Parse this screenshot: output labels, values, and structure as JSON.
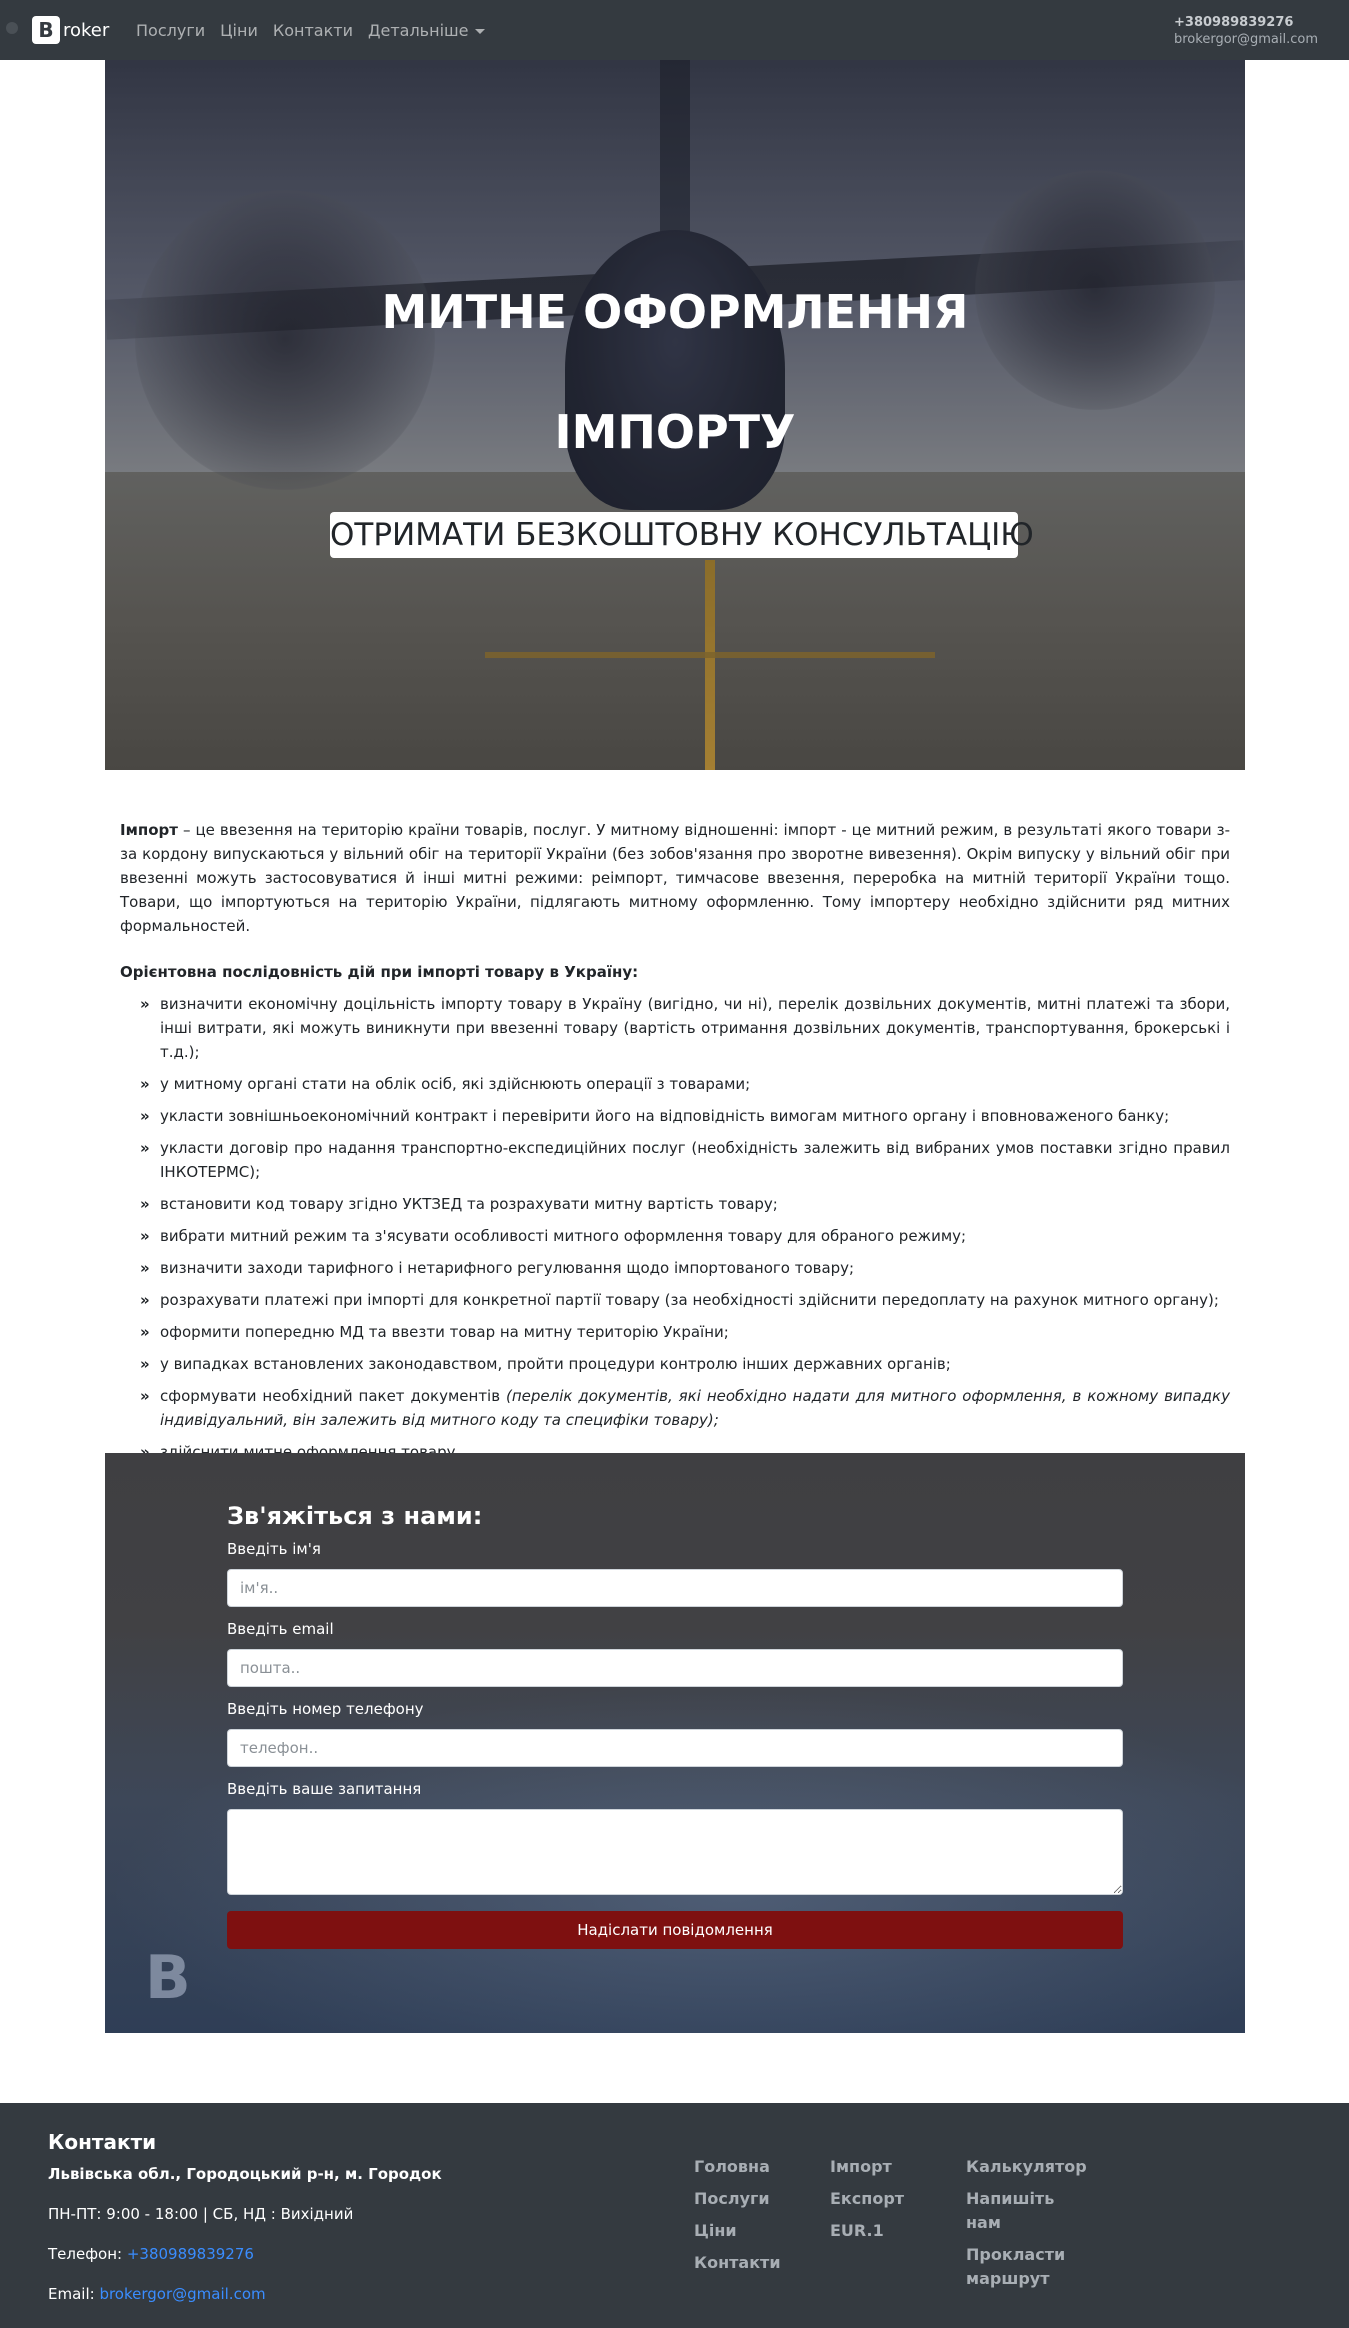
{
  "navbar": {
    "brand_letter": "B",
    "brand_text": "roker",
    "links": [
      "Послуги",
      "Ціни",
      "Контакти"
    ],
    "dropdown_label": "Детальніше",
    "phone": "+380989839276",
    "email": "brokergor@gmail.com"
  },
  "hero": {
    "title_line1": "МИТНЕ ОФОРМЛЕННЯ",
    "title_line2": "ІМПОРТУ",
    "cta": "ОТРИМАТИ БЕЗКОШТОВНУ КОНСУЛЬТАЦІЮ"
  },
  "content": {
    "intro_bold": "Імпорт",
    "intro_text": " – це ввезення на територію країни товарів, послуг. У митному відношенні: імпорт - це митний режим, в результаті якого товари з-за кордону випускаються у вільний обіг на території України (без зобов'язання про зворотне вивезення). Окрім випуску у вільний обіг при ввезенні можуть застосовуватися й інші митні режими: реімпорт, тимчасове ввезення, переробка на митній території України тощо. Товари, що імпортуються на територію України, підлягають митному оформленню. Тому імпортеру необхідно здійснити ряд митних формальностей.",
    "steps_title": "Орієнтовна послідовність дій при імпорті товару в Україну:",
    "steps": [
      "визначити економічну доцільність імпорту товару в Україну (вигідно, чи ні), перелік дозвільних документів, митні платежі та збори, інші витрати, які можуть виникнути при ввезенні товару (вартість отримання дозвільних документів, транспортування, брокерські і т.д.);",
      "у митному органі стати на облік осіб, які здійснюють операції з товарами;",
      "укласти зовнішньоекономічний контракт і перевірити його на відповідність вимогам митного органу і вповноваженого банку;",
      "укласти договір про надання транспортно-експедиційних послуг (необхідність залежить від вибраних умов поставки згідно правил ІНКОТЕРМС);",
      "встановити код товару згідно УКТЗЕД та розрахувати митну вартість товару;",
      "вибрати митний режим та з'ясувати особливості митного оформлення товару для обраного режиму;",
      "визначити заходи тарифного і нетарифного регулювання щодо імпортованого товару;",
      "розрахувати платежі при імпорті для конкретної партії товару (за необхідності здійснити передоплату на рахунок митного органу);",
      "оформити попередню МД та ввезти товар на митну територію України;",
      "у випадках встановлених законодавством, пройти процедури контролю інших державних органів;"
    ],
    "step_docs_prefix": "сформувати необхідний пакет документів ",
    "step_docs_italic": "(перелік документів, які необхідно надати для митного оформлення, в кожному випадку індивідуальний, він залежить від митного коду та специфіки товару);",
    "step_last": "здійснити митне оформлення товару."
  },
  "contact_form": {
    "title": "Зв'яжіться з нами:",
    "name_label": "Введіть ім'я",
    "name_placeholder": "ім'я..",
    "email_label": "Введіть email",
    "email_placeholder": "пошта..",
    "phone_label": "Введіть номер телефону",
    "phone_placeholder": "телефон..",
    "question_label": "Введіть ваше запитання",
    "submit": "Надіслати повідомлення",
    "bg_letter": "B"
  },
  "footer": {
    "title": "Контакти",
    "address": "Львівська обл., Городоцький р-н, м. Городок",
    "hours": "ПН-ПТ: 9:00 - 18:00 | СБ, НД : Вихідний",
    "phone_label": "Телефон: ",
    "phone": "+380989839276",
    "email_label": "Email: ",
    "email": "brokergor@gmail.com",
    "col1": [
      "Головна",
      "Послуги",
      "Ціни",
      "Контакти"
    ],
    "col2": [
      "Імпорт",
      "Експорт",
      "EUR.1"
    ],
    "col3": [
      "Калькулятор",
      "Напишіть нам",
      "Прокласти маршрут"
    ]
  },
  "colors": {
    "navbar_bg": "#343a40",
    "submit_bg": "#7e1010",
    "link_blue": "#3a8dff"
  }
}
